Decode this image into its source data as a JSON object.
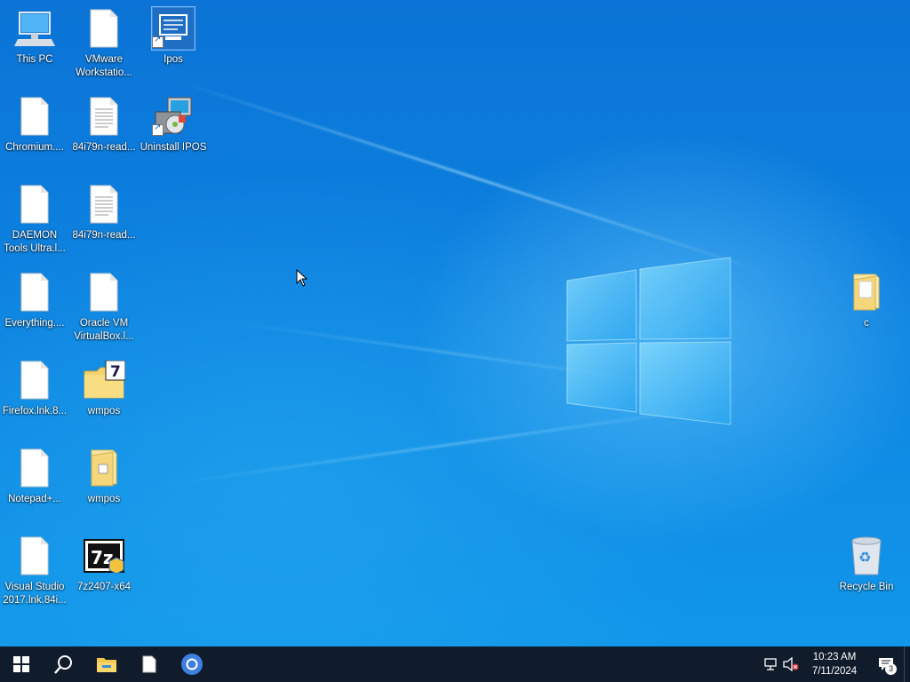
{
  "desktop": {
    "icons": [
      {
        "id": "this-pc",
        "label": "This PC"
      },
      {
        "id": "vmware",
        "label": "VMware Workstatio..."
      },
      {
        "id": "ipos",
        "label": "Ipos"
      },
      {
        "id": "chromium",
        "label": "Chromium...."
      },
      {
        "id": "read1",
        "label": "84i79n-read..."
      },
      {
        "id": "uninstall-ipos",
        "label": "Uninstall IPOS"
      },
      {
        "id": "daemon",
        "label": "DAEMON Tools Ultra.l..."
      },
      {
        "id": "read2",
        "label": "84i79n-read..."
      },
      {
        "id": "everything",
        "label": "Everything...."
      },
      {
        "id": "oracle-vm",
        "label": "Oracle VM VirtualBox.l..."
      },
      {
        "id": "firefox",
        "label": "Firefox.lnk.8..."
      },
      {
        "id": "wmpos-1",
        "label": "wmpos"
      },
      {
        "id": "notepadpp",
        "label": "Notepad+..."
      },
      {
        "id": "wmpos-2",
        "label": "wmpos"
      },
      {
        "id": "vs2017",
        "label": "Visual Studio 2017.lnk.84i..."
      },
      {
        "id": "7z",
        "label": "7z2407-x64"
      },
      {
        "id": "folder-c",
        "label": "c"
      },
      {
        "id": "recycle-bin",
        "label": "Recycle Bin"
      }
    ]
  },
  "taskbar": {
    "start": "start-icon",
    "search": "search-icon",
    "pinned": [
      "file-explorer-icon",
      "document-icon",
      "chromium-icon"
    ],
    "clock": {
      "time": "10:23 AM",
      "date": "7/11/2024"
    },
    "notifications_count": "3"
  },
  "colors": {
    "taskbar": "#101b2b",
    "desktop_accent": "#0b74d6"
  }
}
